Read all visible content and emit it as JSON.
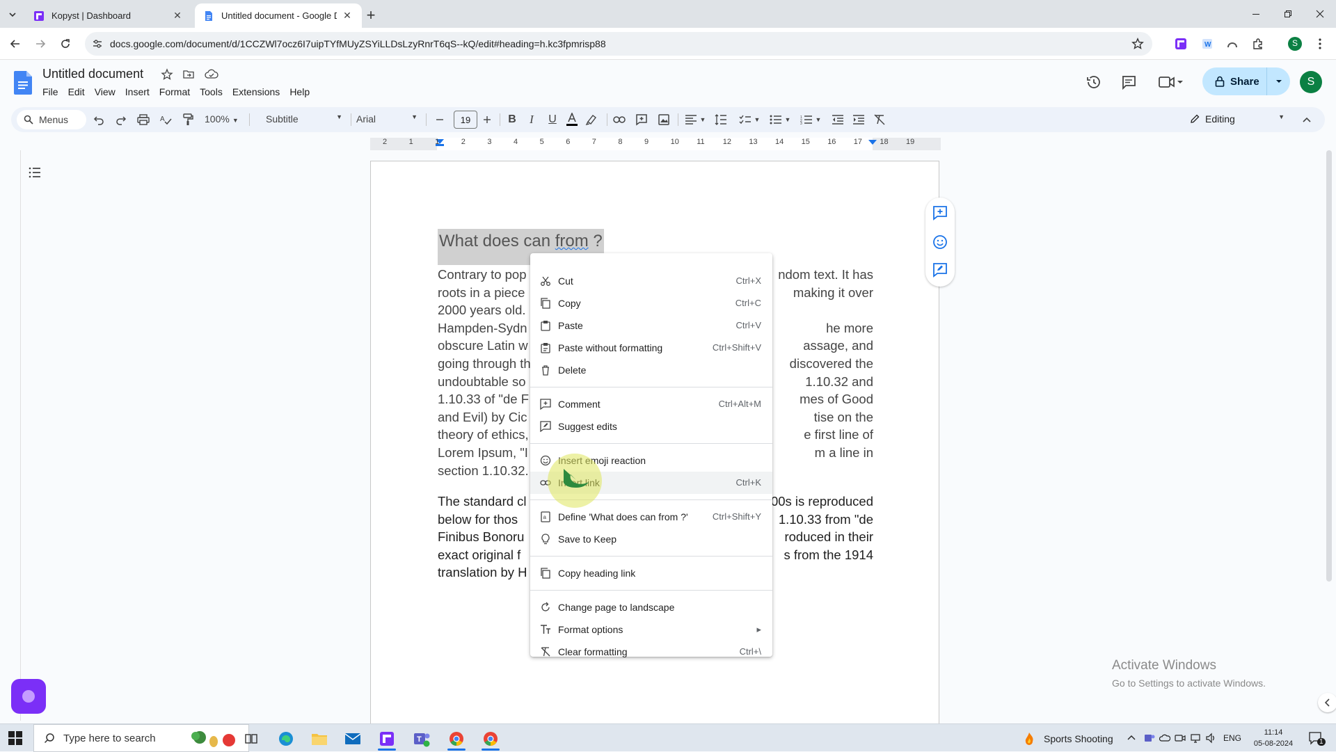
{
  "browser": {
    "tabs": [
      {
        "title": "Kopyst | Dashboard"
      },
      {
        "title": "Untitled document - Google Docs"
      }
    ],
    "url": "docs.google.com/document/d/1CCZWl7ocz6I7uipTYfMUyZSYiLLDsLzyRnrT6qS--kQ/edit#heading=h.kc3fpmrisp88",
    "profile_initial": "S"
  },
  "docs": {
    "title": "Untitled document",
    "menus": [
      "File",
      "Edit",
      "View",
      "Insert",
      "Format",
      "Tools",
      "Extensions",
      "Help"
    ],
    "share_label": "Share",
    "account_initial": "S"
  },
  "toolbar": {
    "menus_label": "Menus",
    "zoom": "100%",
    "style": "Subtitle",
    "font": "Arial",
    "font_size": "19",
    "mode": "Editing"
  },
  "ruler": {
    "numbers": [
      "2",
      "1",
      "1",
      "2",
      "3",
      "4",
      "5",
      "6",
      "7",
      "8",
      "9",
      "10",
      "11",
      "12",
      "13",
      "14",
      "15",
      "16",
      "17",
      "18",
      "19"
    ]
  },
  "document": {
    "heading_before": "What does can ",
    "heading_spell": "from",
    "heading_after": " ?",
    "para1_lines": [
      {
        "l": " Contrary to pop",
        "r": "ndom text. It has"
      },
      {
        "l": "roots in a piece",
        "r": "making it over"
      },
      {
        "l": "2000 years old.",
        "r": ""
      },
      {
        "l": "Hampden-Sydn",
        "r": "he more"
      },
      {
        "l": "obscure Latin w",
        "r": "assage, and"
      },
      {
        "l": "going through th",
        "r": "discovered the"
      },
      {
        "l": "undoubtable so",
        "r": "1.10.32 and"
      },
      {
        "l": "1.10.33 of \"de F",
        "r": "mes of Good"
      },
      {
        "l": "and Evil) by Cic",
        "r": "tise on the"
      },
      {
        "l": "theory of ethics,",
        "r": "e first line of"
      },
      {
        "l": "Lorem Ipsum, \"I",
        "r": "m a line in"
      },
      {
        "l": "section 1.10.32.",
        "r": ""
      }
    ],
    "para2_lines": [
      {
        "l": "The standard cl",
        "r": "00s is reproduced"
      },
      {
        "l": "below for thos",
        "r": "1.10.33 from \"de"
      },
      {
        "l": "Finibus Bonoru",
        "r": "roduced in their"
      },
      {
        "l": "exact original f",
        "r": "s from the 1914"
      },
      {
        "l": "translation by H",
        "r": ""
      }
    ]
  },
  "context_menu": {
    "items": [
      {
        "label": "Cut",
        "shortcut": "Ctrl+X",
        "icon": "scissors-icon"
      },
      {
        "label": "Copy",
        "shortcut": "Ctrl+C",
        "icon": "copy-icon"
      },
      {
        "label": "Paste",
        "shortcut": "Ctrl+V",
        "icon": "paste-icon"
      },
      {
        "label": "Paste without formatting",
        "shortcut": "Ctrl+Shift+V",
        "icon": "paste-plain-icon"
      },
      {
        "label": "Delete",
        "shortcut": "",
        "icon": "trash-icon"
      },
      {
        "label": "Comment",
        "shortcut": "Ctrl+Alt+M",
        "icon": "add-comment-icon"
      },
      {
        "label": "Suggest edits",
        "shortcut": "",
        "icon": "suggest-edits-icon"
      },
      {
        "label": "Insert emoji reaction",
        "shortcut": "",
        "icon": "emoji-icon"
      },
      {
        "label": "Insert link",
        "shortcut": "Ctrl+K",
        "icon": "link-icon"
      },
      {
        "label": "Define 'What does can from ?'",
        "shortcut": "Ctrl+Shift+Y",
        "icon": "dictionary-icon"
      },
      {
        "label": "Save to Keep",
        "shortcut": "",
        "icon": "keep-bulb-icon"
      },
      {
        "label": "Copy heading link",
        "shortcut": "",
        "icon": "copy-link-icon"
      },
      {
        "label": "Change page to landscape",
        "shortcut": "",
        "icon": "rotate-icon"
      },
      {
        "label": "Format options",
        "shortcut": "",
        "icon": "text-format-icon"
      },
      {
        "label": "Clear formatting",
        "shortcut": "Ctrl+\\",
        "icon": "clear-format-icon"
      }
    ]
  },
  "windows_notice": {
    "line1": "Activate Windows",
    "line2": "Go to Settings to activate Windows."
  },
  "taskbar": {
    "search_placeholder": "Type here to search",
    "weather": "Sports Shooting",
    "language": "ENG",
    "time": "11:14",
    "date": "05-08-2024",
    "notifications": "1"
  }
}
